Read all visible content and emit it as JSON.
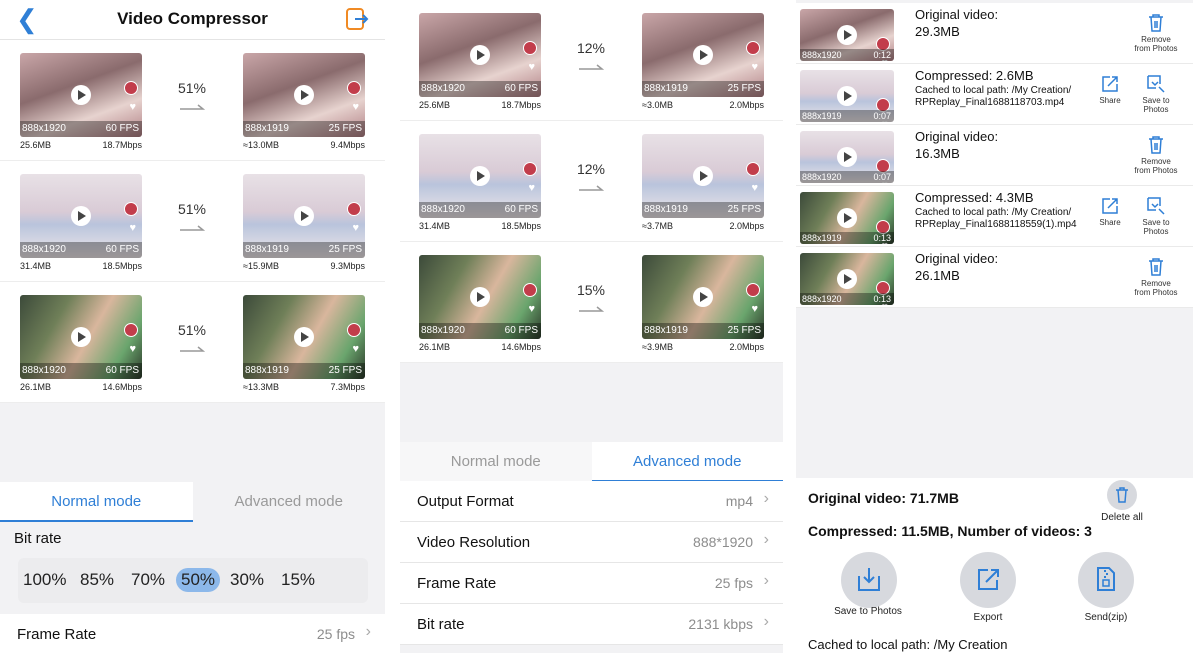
{
  "colors": {
    "accent": "#2f7fd6",
    "selected_rate": "#8cb8ea",
    "bg": "#f2f2f4"
  },
  "header": {
    "title": "Video Compressor",
    "back_icon": "chevron-left-icon",
    "export_icon": "export-icon"
  },
  "panel1": {
    "rows": [
      {
        "thumb": "t1",
        "orig": {
          "res": "888x1920",
          "fps": "60 FPS",
          "size": "25.6MB",
          "bitrate": "18.7Mbps"
        },
        "pct": "51%",
        "comp": {
          "res": "888x1919",
          "fps": "25 FPS",
          "size": "≈13.0MB",
          "bitrate": "9.4Mbps"
        }
      },
      {
        "thumb": "t2",
        "orig": {
          "res": "888x1920",
          "fps": "60 FPS",
          "size": "31.4MB",
          "bitrate": "18.5Mbps"
        },
        "pct": "51%",
        "comp": {
          "res": "888x1919",
          "fps": "25 FPS",
          "size": "≈15.9MB",
          "bitrate": "9.3Mbps"
        }
      },
      {
        "thumb": "t3",
        "orig": {
          "res": "888x1920",
          "fps": "60 FPS",
          "size": "26.1MB",
          "bitrate": "14.6Mbps"
        },
        "pct": "51%",
        "comp": {
          "res": "888x1919",
          "fps": "25 FPS",
          "size": "≈13.3MB",
          "bitrate": "7.3Mbps"
        }
      }
    ],
    "tabs": {
      "normal": "Normal mode",
      "advanced": "Advanced mode"
    },
    "bitrate_label": "Bit rate",
    "rates": [
      "100%",
      "85%",
      "70%",
      "50%",
      "30%",
      "15%"
    ],
    "selected_rate": "50%",
    "frame_rate": {
      "label": "Frame Rate",
      "value": "25 fps"
    }
  },
  "panel2": {
    "rows": [
      {
        "thumb": "t1",
        "orig": {
          "res": "888x1920",
          "fps": "60 FPS",
          "size": "25.6MB",
          "bitrate": "18.7Mbps"
        },
        "pct": "12%",
        "comp": {
          "res": "888x1919",
          "fps": "25 FPS",
          "size": "≈3.0MB",
          "bitrate": "2.0Mbps"
        }
      },
      {
        "thumb": "t2",
        "orig": {
          "res": "888x1920",
          "fps": "60 FPS",
          "size": "31.4MB",
          "bitrate": "18.5Mbps"
        },
        "pct": "12%",
        "comp": {
          "res": "888x1919",
          "fps": "25 FPS",
          "size": "≈3.7MB",
          "bitrate": "2.0Mbps"
        }
      },
      {
        "thumb": "t3",
        "orig": {
          "res": "888x1920",
          "fps": "60 FPS",
          "size": "26.1MB",
          "bitrate": "14.6Mbps"
        },
        "pct": "15%",
        "comp": {
          "res": "888x1919",
          "fps": "25 FPS",
          "size": "≈3.9MB",
          "bitrate": "2.0Mbps"
        }
      }
    ],
    "tabs": {
      "normal": "Normal mode",
      "advanced": "Advanced mode"
    },
    "settings": [
      {
        "label": "Output Format",
        "value": "mp4"
      },
      {
        "label": "Video Resolution",
        "value": "888*1920"
      },
      {
        "label": "Frame Rate",
        "value": "25 fps"
      },
      {
        "label": "Bit rate",
        "value": "2131 kbps"
      }
    ]
  },
  "panel3": {
    "items": [
      {
        "type": "original",
        "thumb": "t1",
        "res": "888x1920",
        "dur": "0:12",
        "heading": "Original video:",
        "size": "29.3MB",
        "action": "Remove from Photos"
      },
      {
        "type": "compressed",
        "thumb": "t2",
        "res": "888x1919",
        "dur": "0:07",
        "heading": "Compressed: 2.6MB",
        "path": "Cached to local path: /My Creation/ RPReplay_Final1688118703.mp4",
        "share": "Share",
        "save": "Save to Photos"
      },
      {
        "type": "original",
        "thumb": "t2",
        "res": "888x1920",
        "dur": "0:07",
        "heading": "Original video:",
        "size": "16.3MB",
        "action": "Remove from Photos"
      },
      {
        "type": "compressed",
        "thumb": "t3",
        "res": "888x1919",
        "dur": "0:13",
        "heading": "Compressed: 4.3MB",
        "path": "Cached to local path: /My Creation/ RPReplay_Final1688118559(1).mp4",
        "share": "Share",
        "save": "Save to Photos"
      },
      {
        "type": "original",
        "thumb": "t3",
        "res": "888x1920",
        "dur": "0:13",
        "heading": "Original video:",
        "size": "26.1MB",
        "action": "Remove from Photos"
      }
    ],
    "summary": {
      "original": "Original video: 71.7MB",
      "compressed": "Compressed: 11.5MB, Number of videos: 3",
      "delete_all": "Delete all",
      "save": "Save to Photos",
      "export": "Export",
      "send": "Send(zip)",
      "cached": "Cached to local path: /My Creation"
    }
  }
}
